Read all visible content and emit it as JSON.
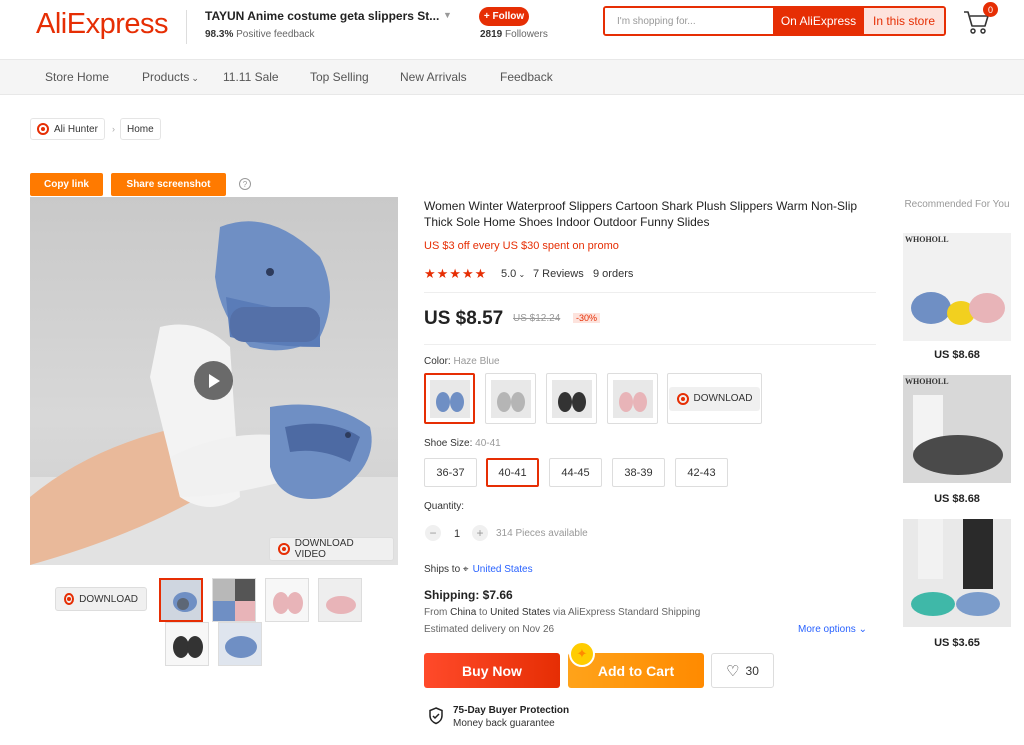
{
  "header": {
    "logo": "AliExpress",
    "store_name": "TAYUN Anime costume geta slippers St...",
    "feedback_pct": "98.3%",
    "feedback_label": "Positive feedback",
    "follow_label": "+ Follow",
    "followers_count": "2819",
    "followers_label": "Followers",
    "search_placeholder": "I'm shopping for...",
    "search_ae": "On AliExpress",
    "search_store": "In this store",
    "cart_count": "0"
  },
  "nav": {
    "items": [
      "Store Home",
      "Products",
      "11.11 Sale",
      "Top Selling",
      "New Arrivals",
      "Feedback"
    ]
  },
  "breadcrumb": {
    "ext": "Ali Hunter",
    "home": "Home"
  },
  "tools": {
    "copy": "Copy link",
    "share": "Share screenshot",
    "help": "?"
  },
  "gallery": {
    "download_video": "DOWNLOAD VIDEO",
    "download": "DOWNLOAD"
  },
  "product": {
    "title": "Women Winter Waterproof Slippers Cartoon Shark Plush Slippers Warm Non-Slip Thick Sole Home Shoes Indoor Outdoor Funny Slides",
    "promo": "US $3 off every US $30 spent on promo",
    "stars": "★★★★★",
    "rating": "5.0",
    "reviews": "7 Reviews",
    "orders": "9 orders",
    "price": "US $8.57",
    "old_price": "US $12.24",
    "discount": "-30%"
  },
  "options": {
    "color_label": "Color:",
    "color_value": "Haze Blue",
    "download": "DOWNLOAD",
    "size_label": "Shoe Size:",
    "size_value": "40-41",
    "sizes": [
      "36-37",
      "40-41",
      "44-45",
      "38-39",
      "42-43"
    ],
    "qty_label": "Quantity:",
    "qty_minus": "−",
    "qty_value": "1",
    "qty_plus": "+",
    "available": "314 Pieces available"
  },
  "shipping": {
    "ships_to": "Ships to",
    "country": "United States",
    "cost": "Shipping: $7.66",
    "from_text": "From",
    "from": "China",
    "to_text": "to",
    "to": "United States",
    "via": "via AliExpress Standard Shipping",
    "estimated": "Estimated delivery on Nov 26",
    "more": "More options"
  },
  "actions": {
    "buy_now": "Buy Now",
    "add_to_cart": "Add to Cart",
    "wishlist_count": "30"
  },
  "protection": {
    "title": "75-Day Buyer Protection",
    "subtitle": "Money back guarantee"
  },
  "recommended": {
    "title": "Recommended For You",
    "items": [
      {
        "watermark": "WHOHOLL",
        "price": "US $8.68"
      },
      {
        "watermark": "WHOHOLL",
        "price": "US $8.68"
      },
      {
        "watermark": "",
        "price": "US $3.65"
      }
    ]
  },
  "colors": {
    "accent": "#e62e04",
    "orange": "#ff8a00",
    "link": "#2962ff"
  }
}
